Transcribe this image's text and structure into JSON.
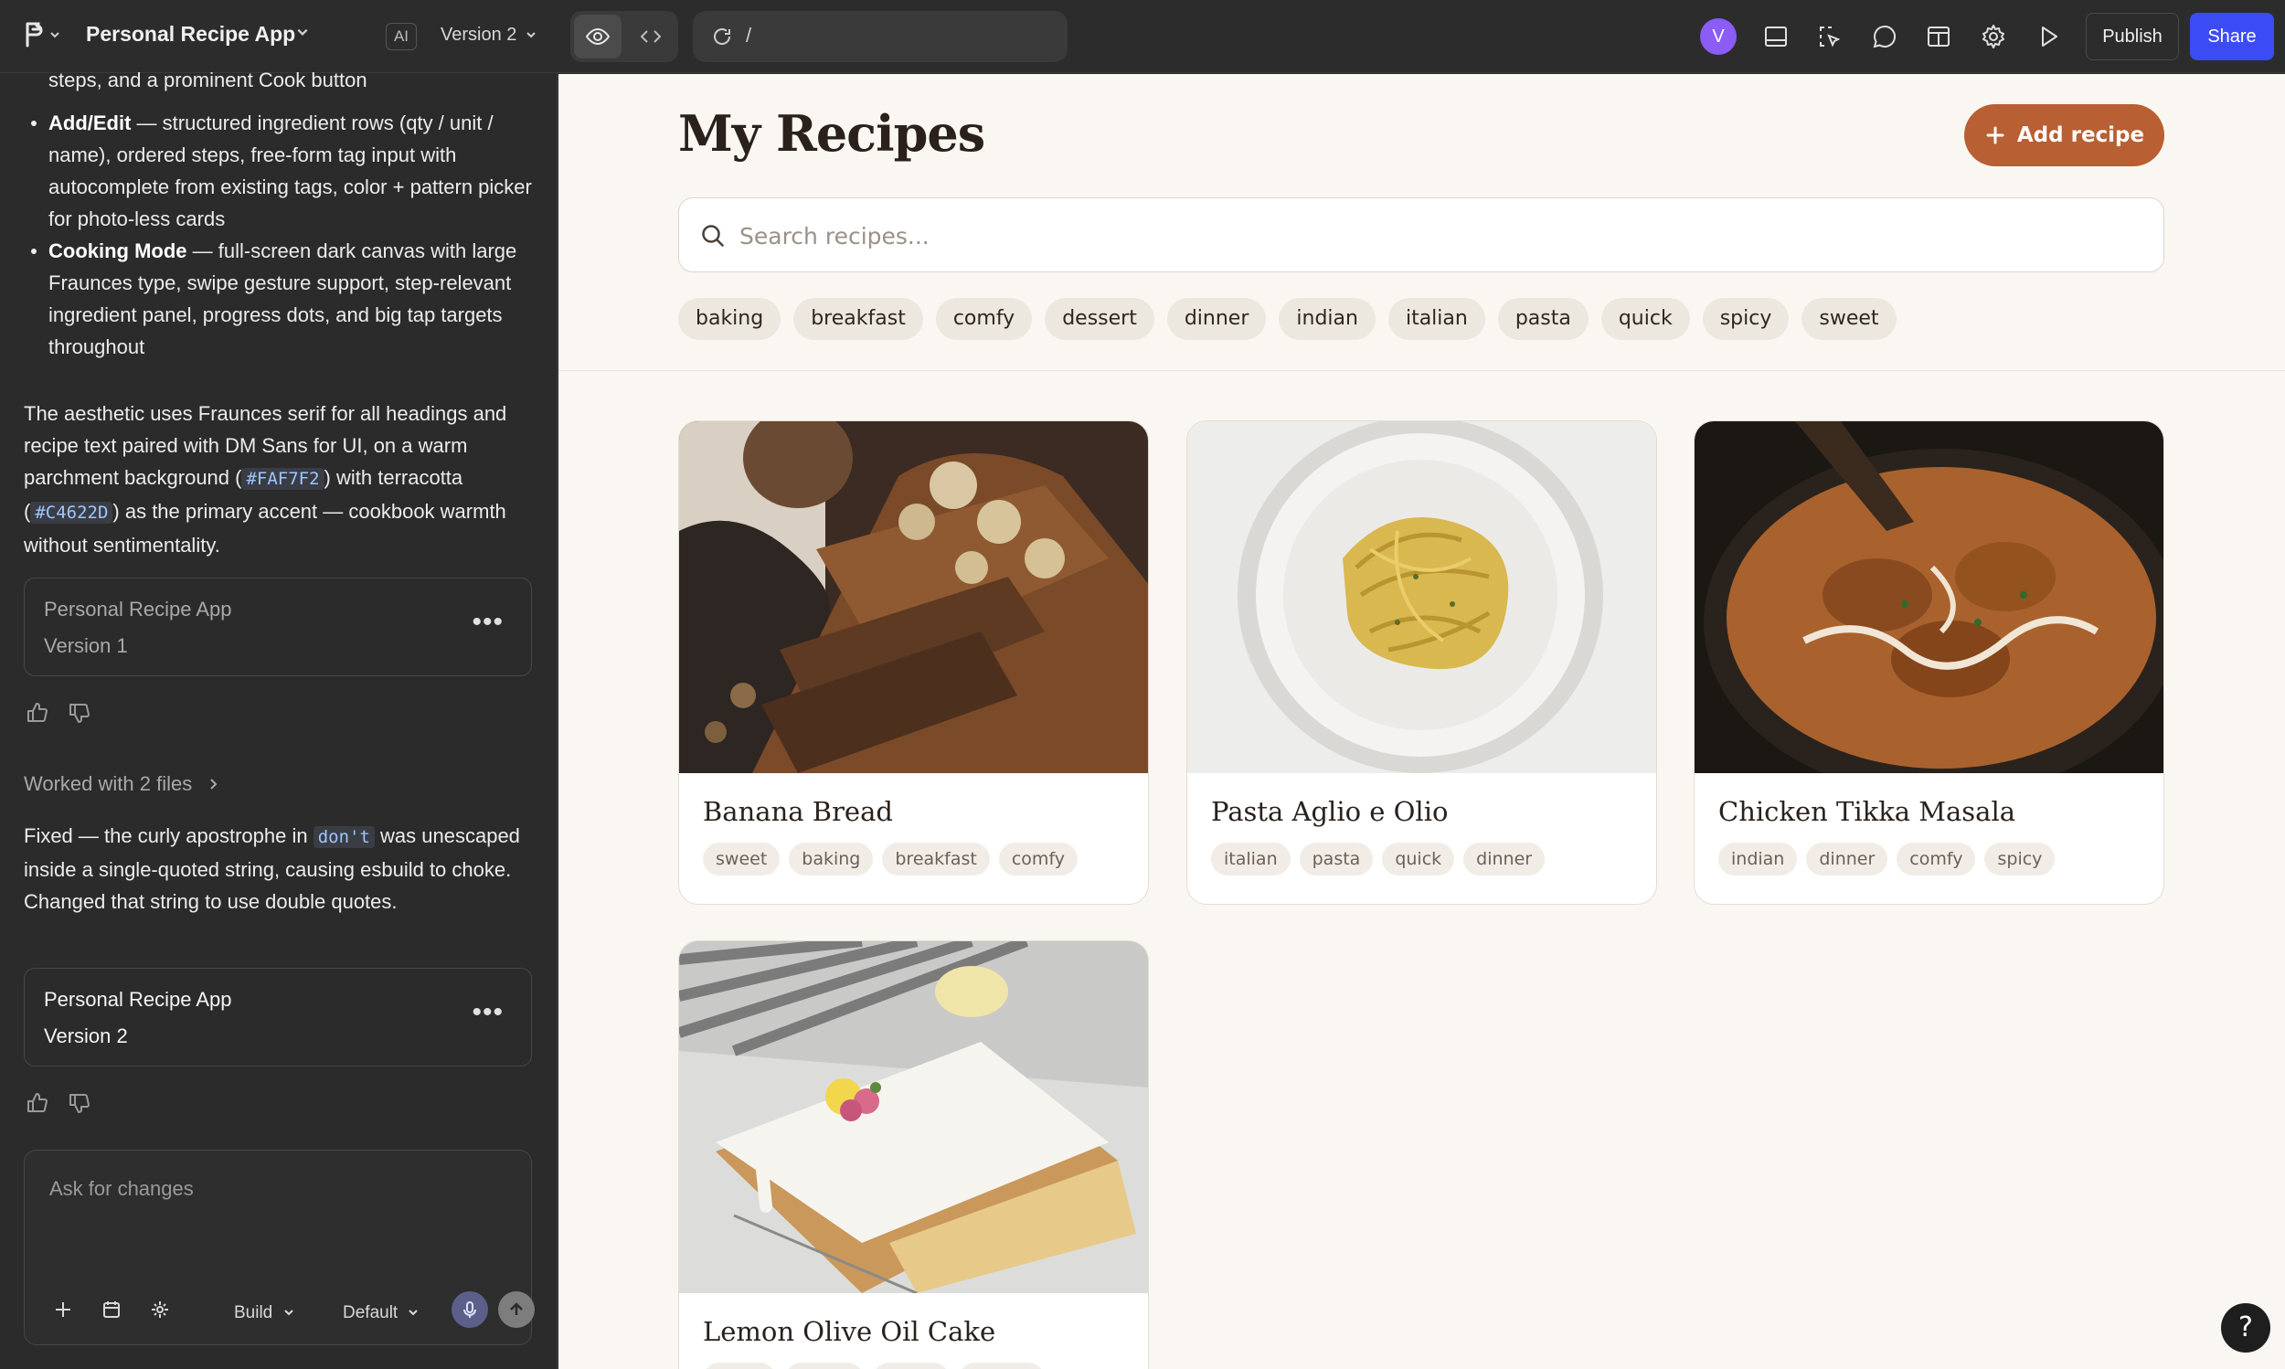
{
  "topbar": {
    "app_title": "Personal Recipe App",
    "ai_badge": "AI",
    "version_label": "Version 2",
    "url_path": "/",
    "avatar_initial": "V",
    "publish_label": "Publish",
    "share_label": "Share",
    "colors": {
      "share": "#3b4cf5",
      "avatar": "#8b5cf6"
    }
  },
  "chat": {
    "intro_tail": "steps, and a prominent Cook button",
    "bullets": [
      {
        "title": "Add/Edit",
        "text": " — structured ingredient rows (qty / unit / name), ordered steps, free-form tag input with autocomplete from existing tags, color + pattern picker for photo-less cards"
      },
      {
        "title": "Cooking Mode",
        "text": " — full-screen dark canvas with large Fraunces type, swipe gesture support, step-relevant ingredient panel, progress dots, and big tap targets throughout"
      }
    ],
    "aesthetic": {
      "part1": "The aesthetic uses Fraunces serif for all headings and recipe text paired with DM Sans for UI, on a warm parchment background (",
      "code1": "#FAF7F2",
      "part2": ") with terracotta (",
      "code2": "#C4622D",
      "part3": ") as the primary accent — cookbook warmth without sentimentality."
    },
    "version_cards": [
      {
        "title": "Personal Recipe App",
        "version": "Version 1"
      },
      {
        "title": "Personal Recipe App",
        "version": "Version 2"
      }
    ],
    "worked_with": "Worked with 2 files",
    "fix_message": {
      "part1": "Fixed — the curly apostrophe in ",
      "code": "don't",
      "part2": " was unescaped inside a single-quoted string, causing esbuild to choke. Changed that string to use double quotes."
    },
    "composer": {
      "placeholder": "Ask for changes",
      "mode": "Build",
      "model": "Default"
    }
  },
  "preview": {
    "title": "My Recipes",
    "add_button": "Add recipe",
    "search_placeholder": "Search recipes...",
    "filter_tags": [
      "baking",
      "breakfast",
      "comfy",
      "dessert",
      "dinner",
      "indian",
      "italian",
      "pasta",
      "quick",
      "spicy",
      "sweet"
    ],
    "recipes": [
      {
        "name": "Banana Bread",
        "tags": [
          "sweet",
          "baking",
          "breakfast",
          "comfy"
        ]
      },
      {
        "name": "Pasta Aglio e Olio",
        "tags": [
          "italian",
          "pasta",
          "quick",
          "dinner"
        ]
      },
      {
        "name": "Chicken Tikka Masala",
        "tags": [
          "indian",
          "dinner",
          "comfy",
          "spicy"
        ]
      },
      {
        "name": "Lemon Olive Oil Cake",
        "tags": [
          "",
          "",
          "",
          ""
        ]
      }
    ],
    "help_label": "?",
    "colors": {
      "background": "#faf7f2",
      "accent": "#b85f33"
    }
  }
}
